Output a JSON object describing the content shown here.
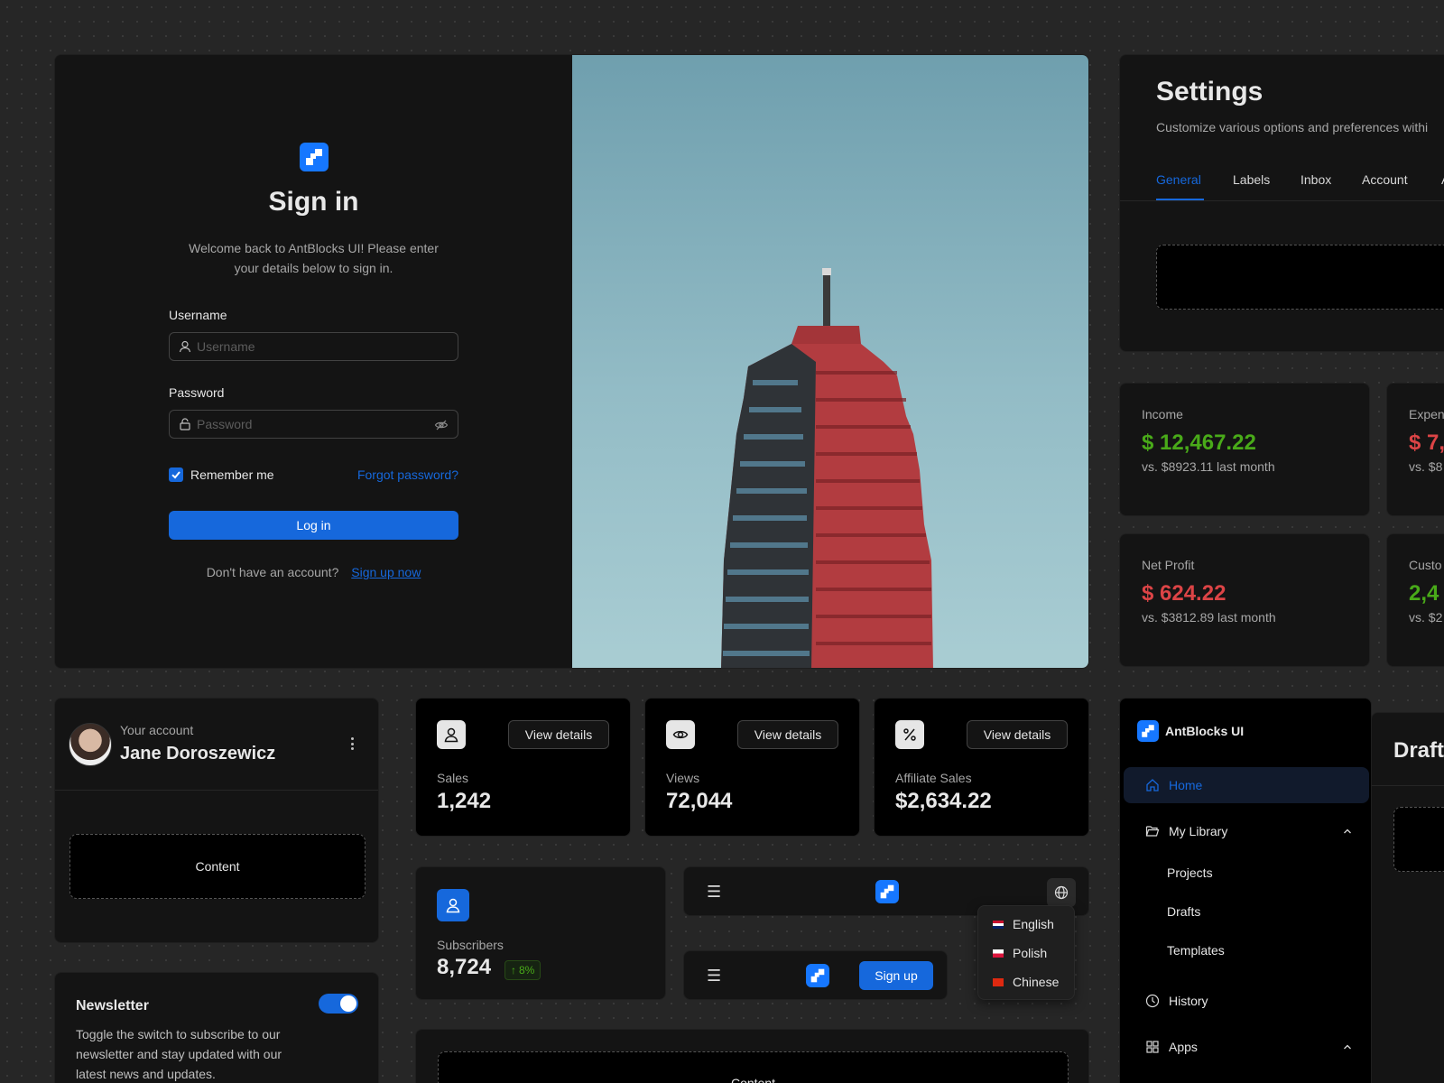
{
  "signin": {
    "title": "Sign in",
    "welcome_line1": "Welcome back to AntBlocks UI! Please enter",
    "welcome_line2": "your details below to sign in.",
    "username_label": "Username",
    "username_placeholder": "Username",
    "password_label": "Password",
    "password_placeholder": "Password",
    "remember_label": "Remember me",
    "remember_checked": true,
    "forgot_link": "Forgot password?",
    "login_button": "Log in",
    "no_account_text": "Don't have an account?",
    "signup_link": "Sign up now"
  },
  "settings": {
    "title": "Settings",
    "subtitle": "Customize various options and preferences withi",
    "tabs": [
      "General",
      "Labels",
      "Inbox",
      "Account",
      "A"
    ],
    "active_tab": "General"
  },
  "finance": {
    "income_label": "Income",
    "income_value": "$ 12,467.22",
    "income_compare": "vs. $8923.11 last month",
    "expenses_label": "Expen",
    "expenses_value": "$ 7,",
    "expenses_compare": "vs. $8",
    "profit_label": "Net Profit",
    "profit_value": "$ 624.22",
    "profit_compare": "vs. $3812.89 last month",
    "customers_label": "Custo",
    "customers_value": "2,4",
    "customers_compare": "vs. $2"
  },
  "account": {
    "overline": "Your account",
    "name": "Jane Doroszewicz",
    "content_label": "Content"
  },
  "metrics": [
    {
      "label": "Sales",
      "value": "1,242",
      "button": "View details",
      "icon": "user-icon"
    },
    {
      "label": "Views",
      "value": "72,044",
      "button": "View details",
      "icon": "eye-icon"
    },
    {
      "label": "Affiliate Sales",
      "value": "$2,634.22",
      "button": "View details",
      "icon": "percent-icon"
    }
  ],
  "subscribers": {
    "label": "Subscribers",
    "value": "8,724",
    "change": "8%"
  },
  "header_demo": {
    "signup_button": "Sign up",
    "languages": [
      "English",
      "Polish",
      "Chinese"
    ]
  },
  "newsletter": {
    "title": "Newsletter",
    "description_line1": "Toggle the switch to subscribe to our",
    "description_line2": "newsletter and stay updated with our",
    "description_line3": "latest news and updates.",
    "enabled": true
  },
  "bottom_content": {
    "label": "Content"
  },
  "sidebar": {
    "brand": "AntBlocks UI",
    "items": {
      "home": "Home",
      "library": "My Library",
      "projects": "Projects",
      "drafts": "Drafts",
      "templates": "Templates",
      "history": "History",
      "apps": "Apps"
    },
    "draft_heading": "Draft"
  },
  "colors": {
    "accent": "#1668dc",
    "positive": "#49aa19",
    "negative": "#dc4446"
  }
}
